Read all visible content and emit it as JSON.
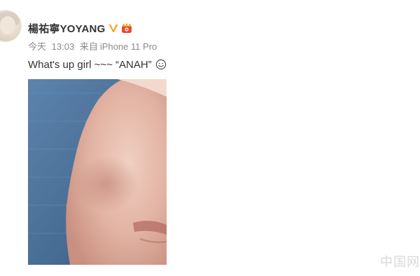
{
  "post": {
    "author": {
      "name": "楊祐寧YOYANG",
      "verified_icon": "verified-badge-icon",
      "vip_icon": "vip-member-icon",
      "accent_color": "#f5a623"
    },
    "meta": {
      "date": "今天",
      "time": "13:03",
      "source_prefix": "来自",
      "source_device": "iPhone 11 Pro"
    },
    "text": "What's up girl ~~~ “ANAH”",
    "emoji_icon": "smile-emoji-icon",
    "image": {
      "description_icon": "photo-thumbnail"
    }
  },
  "watermark": "中国网"
}
